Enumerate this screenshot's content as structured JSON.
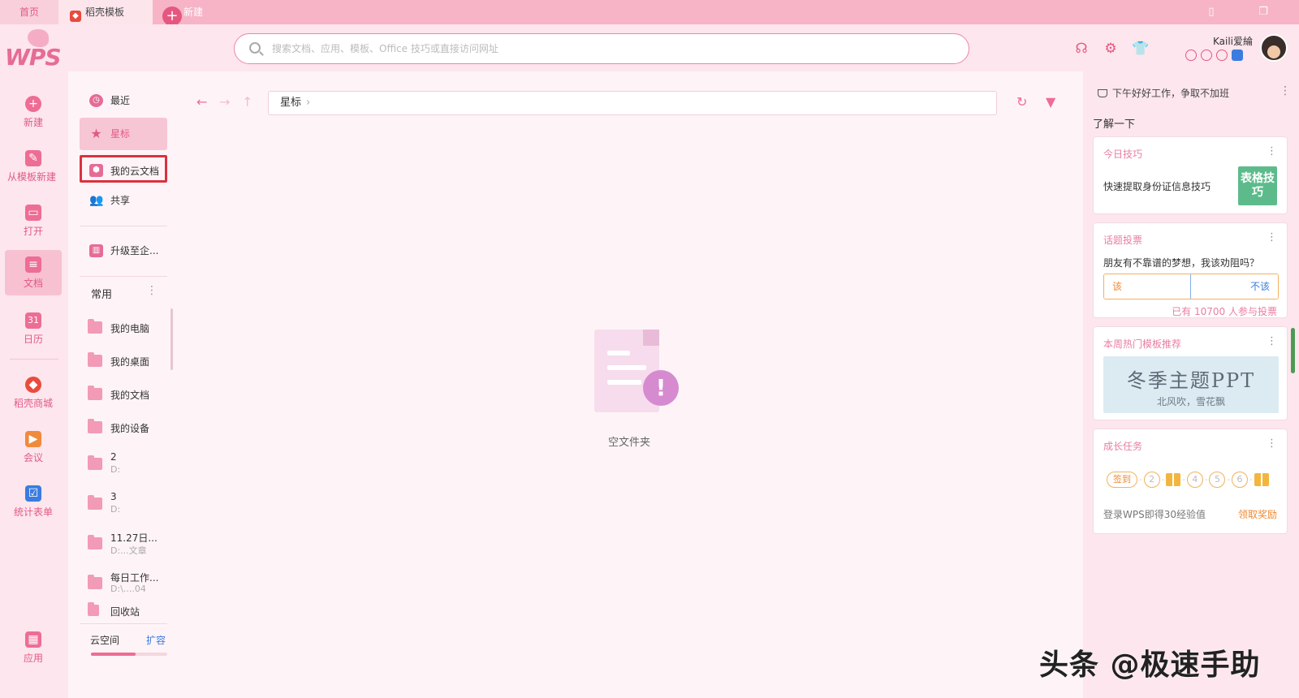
{
  "tabs": {
    "home": "首页",
    "template": "稻壳模板",
    "new": "新建"
  },
  "header": {
    "logo": "WPS",
    "search_placeholder": "搜索文档、应用、模板、Office 技巧或直接访问网址",
    "username": "Kaili爱綸"
  },
  "rail": {
    "new": "新建",
    "from_template": "从模板新建",
    "open": "打开",
    "docs": "文档",
    "calendar": "日历",
    "calendar_day": "31",
    "store": "稻壳商城",
    "meeting": "会议",
    "forms": "统计表单",
    "apps": "应用"
  },
  "sidebar": {
    "recent": "最近",
    "starred": "星标",
    "cloud_docs": "我的云文档",
    "shared": "共享",
    "upgrade": "升级至企...",
    "common_label": "常用",
    "folders": [
      {
        "name": "我的电脑",
        "path": ""
      },
      {
        "name": "我的桌面",
        "path": ""
      },
      {
        "name": "我的文档",
        "path": ""
      },
      {
        "name": "我的设备",
        "path": ""
      },
      {
        "name": "2",
        "path": "D:"
      },
      {
        "name": "3",
        "path": "D:"
      },
      {
        "name": "11.27日...",
        "path": "D:...文章"
      },
      {
        "name": "每日工作...",
        "path": "D:\\....04"
      }
    ],
    "trash": "回收站",
    "cloud_space": "云空间",
    "expand": "扩容",
    "cloud_usage_fraction": 0.58
  },
  "main": {
    "path": "星标",
    "empty_text": "空文件夹"
  },
  "right_panel": {
    "greeting": "下午好好工作，争取不加班",
    "learn": "了解一下",
    "tip": {
      "title": "今日技巧",
      "text": "快速提取身份证信息技巧",
      "image_text": "表格技巧"
    },
    "vote": {
      "title": "话题投票",
      "question": "朋友有不靠谱的梦想，我该劝阻吗？",
      "yes": "该",
      "no": "不该",
      "count": "已有 10700 人参与投票"
    },
    "templates": {
      "title": "本周热门模板推荐",
      "tpl_title": "冬季主题PPT",
      "tpl_sub": "北风吹，雪花飘"
    },
    "tasks": {
      "title": "成长任务",
      "checkin": "签到",
      "steps": [
        "2",
        "4",
        "5",
        "6"
      ],
      "text": "登录WPS即得30经验值",
      "claim": "领取奖励"
    }
  },
  "watermark": "头条 @极速手助",
  "colors": {
    "accent": "#e6577f",
    "active_bg": "#f7c6d5",
    "highlight_box": "#d9323e"
  }
}
